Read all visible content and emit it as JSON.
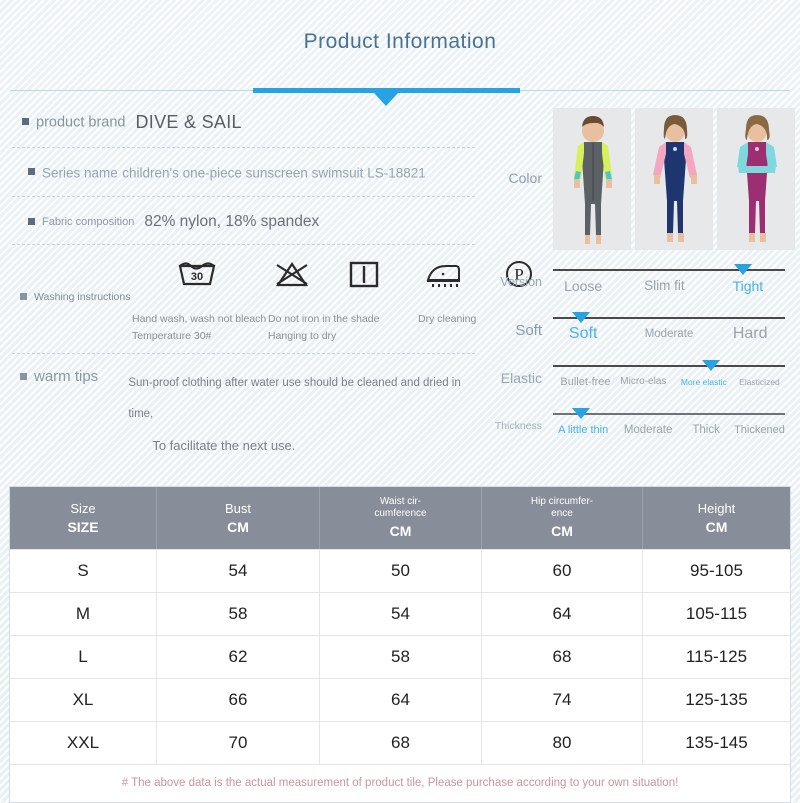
{
  "header": {
    "title": "Product Information"
  },
  "specs": {
    "brand": {
      "label": "product brand",
      "value": "DIVE & SAIL"
    },
    "series": {
      "label": "Series name",
      "value": "children's one-piece sunscreen swimsuit LS-18821"
    },
    "fabric": {
      "label": "Fabric composition",
      "value": "82% nylon, 18% spandex"
    },
    "washing": {
      "label": "Washing instructions",
      "items": [
        {
          "icon": "hand-wash-30-icon",
          "line1": "Hand wash, wash not bleach",
          "line2": "Temperature 30#"
        },
        {
          "icon": "no-bleach-icon",
          "line1": "",
          "line2": ""
        },
        {
          "icon": "hang-to-dry-icon",
          "line1": "Do not iron in the shade",
          "line2": "Hanging to dry"
        },
        {
          "icon": "iron-icon",
          "line1": "",
          "line2": ""
        },
        {
          "icon": "dry-cleaning-p-icon",
          "line1": "Dry cleaning",
          "line2": ""
        }
      ]
    },
    "tips": {
      "label": "warm tips",
      "line1": "Sun-proof clothing after water use should be cleaned and dried in time,",
      "line2": "To facilitate the next use."
    }
  },
  "attributes": {
    "color": {
      "label": "Color",
      "swatches": [
        {
          "name": "grey-yellow-boy-swimsuit",
          "suit": "#5c6166",
          "sleeve": "#d8f05a",
          "accent": "#4ec6c6",
          "skin": "#e8c0a0",
          "hair": "#6b4a33"
        },
        {
          "name": "navy-pink-girl-swimsuit",
          "suit": "#1f3570",
          "sleeve": "#f4a7c0",
          "accent": "#f4a7c0",
          "skin": "#e8c0a0",
          "hair": "#7a5a3a"
        },
        {
          "name": "magenta-cyan-girl-swimsuit",
          "suit": "#9c2f72",
          "sleeve": "#7fd8dc",
          "accent": "#7fd8dc",
          "skin": "#e8c0a0",
          "hair": "#8a6a45"
        }
      ]
    },
    "sliders": [
      {
        "name": "version",
        "label": "Version",
        "marker_pct": 82,
        "ticks": [
          {
            "text": "Loose",
            "pct": 13,
            "size": 14,
            "selected": false
          },
          {
            "text": "Slim fit",
            "pct": 48,
            "size": 13.5,
            "selected": false
          },
          {
            "text": "Tight",
            "pct": 84,
            "size": 14,
            "selected": true
          }
        ]
      },
      {
        "name": "soft",
        "label": "Soft",
        "marker_pct": 12,
        "ticks": [
          {
            "text": "Soft",
            "pct": 13,
            "size": 16,
            "selected": true
          },
          {
            "text": "Moderate",
            "pct": 50,
            "size": 11.5,
            "selected": false
          },
          {
            "text": "Hard",
            "pct": 85,
            "size": 16,
            "selected": false
          }
        ]
      },
      {
        "name": "elastic",
        "label": "Elastic",
        "marker_pct": 68,
        "ticks": [
          {
            "text": "Bullet-free",
            "pct": 14,
            "size": 11,
            "selected": false
          },
          {
            "text": "Micro-elas-tic",
            "pct": 39,
            "size": 10,
            "selected": false
          },
          {
            "text": "More elastic",
            "pct": 65,
            "size": 8.5,
            "selected": true
          },
          {
            "text": "Elasticized",
            "pct": 89,
            "size": 8.5,
            "selected": false
          }
        ]
      },
      {
        "name": "thickness",
        "label": "Thickness",
        "marker_pct": 12,
        "ticks": [
          {
            "text": "A little thin",
            "pct": 13,
            "size": 11,
            "selected": true
          },
          {
            "text": "Moderate",
            "pct": 41,
            "size": 11.5,
            "selected": false
          },
          {
            "text": "Thick",
            "pct": 66,
            "size": 11.5,
            "selected": false
          },
          {
            "text": "Thickened",
            "pct": 89,
            "size": 11,
            "selected": false
          }
        ]
      }
    ]
  },
  "size_table": {
    "headers": [
      {
        "top": "Size",
        "unit": "SIZE",
        "small": false
      },
      {
        "top": "Bust",
        "unit": "CM",
        "small": false
      },
      {
        "top": "Waist cir-cumference",
        "unit": "CM",
        "small": true
      },
      {
        "top": "Hip circumfer-ence",
        "unit": "CM",
        "small": true
      },
      {
        "top": "Height",
        "unit": "CM",
        "small": false
      }
    ],
    "rows": [
      [
        "S",
        "54",
        "50",
        "60",
        "95-105"
      ],
      [
        "M",
        "58",
        "54",
        "64",
        "105-115"
      ],
      [
        "L",
        "62",
        "58",
        "68",
        "115-125"
      ],
      [
        "XL",
        "66",
        "64",
        "74",
        "125-135"
      ],
      [
        "XXL",
        "70",
        "68",
        "80",
        "135-145"
      ]
    ],
    "note": "# The above data is the actual measurement of product tile, Please purchase according to your own situation!"
  },
  "colors": {
    "accent": "#27a3e3",
    "title": "#4a7291",
    "table_header": "#878e99",
    "note": "#c9949c"
  }
}
